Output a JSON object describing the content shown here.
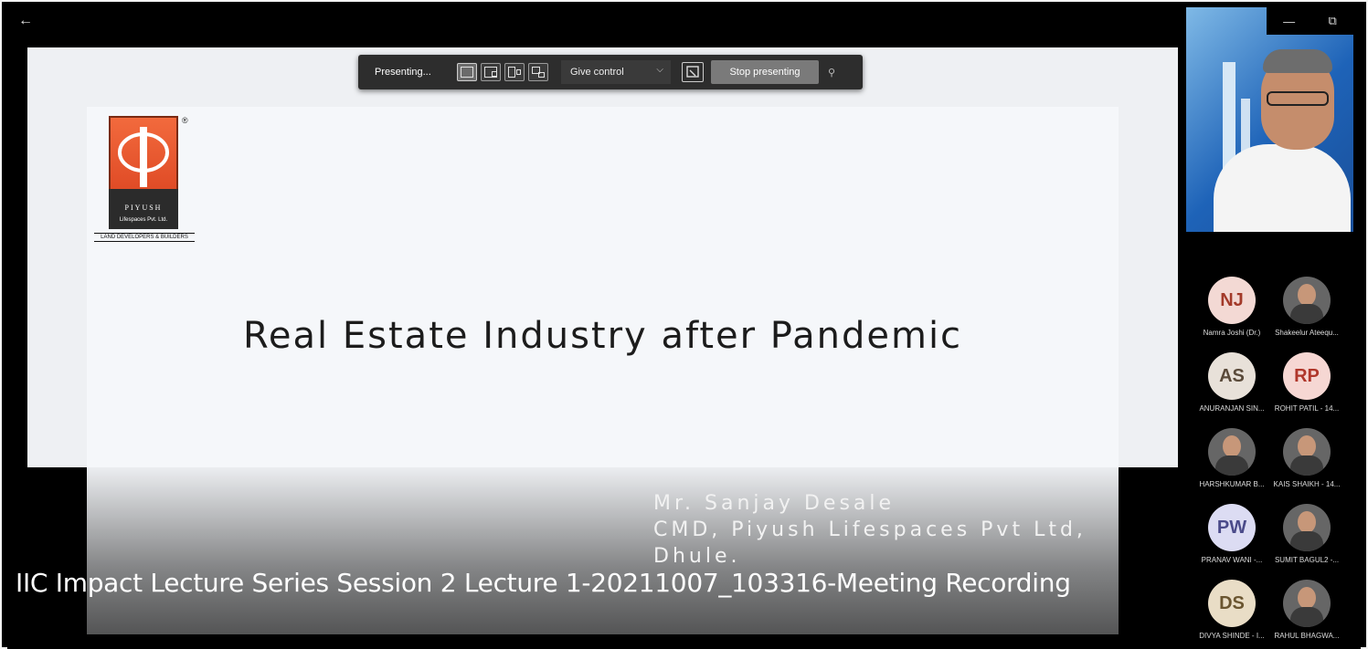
{
  "toolbar": {
    "presenting_label": "Presenting...",
    "give_control_label": "Give control",
    "stop_presenting_label": "Stop presenting"
  },
  "slide": {
    "title": "Real Estate Industry after Pandemic",
    "logo": {
      "brand": "PIYUSH",
      "brand_sub": "Lifespaces Pvt. Ltd.",
      "tagline": "LAND DEVELOPERS & BUILDERS"
    },
    "presenter_lines": [
      "Mr. Sanjay Desale",
      "CMD, Piyush Lifespaces Pvt Ltd,",
      "Dhule."
    ]
  },
  "recording_title": "IIC Impact Lecture Series Session 2 Lecture 1-20211007_103316-Meeting Recording",
  "participants": [
    {
      "initials": "NJ",
      "name": "Namra Joshi (Dr.)",
      "bg": "#f3d9d4",
      "fg": "#a33a2a"
    },
    {
      "initials": "",
      "name": "Shakeelur Ateequ...",
      "photo": true
    },
    {
      "initials": "AS",
      "name": "ANURANJAN SIN...",
      "bg": "#e8e1d9",
      "fg": "#5a4a3a"
    },
    {
      "initials": "RP",
      "name": "ROHIT PATIL - 14...",
      "bg": "#f6d7d3",
      "fg": "#b0372b"
    },
    {
      "initials": "",
      "name": "HARSHKUMAR B...",
      "photo": true
    },
    {
      "initials": "",
      "name": "KAIS SHAIKH - 14...",
      "photo": true
    },
    {
      "initials": "PW",
      "name": "PRANAV WANI -...",
      "bg": "#dcdcf3",
      "fg": "#4b4b8a"
    },
    {
      "initials": "",
      "name": "SUMIT BAGUL2 -...",
      "photo": true
    },
    {
      "initials": "DS",
      "name": "DIVYA SHINDE - I...",
      "bg": "#e9ddc6",
      "fg": "#6a5530"
    },
    {
      "initials": "",
      "name": "RAHUL BHAGWA...",
      "photo": true
    }
  ],
  "window": {
    "minimize_glyph": "—",
    "restore_glyph": "⧉"
  },
  "icons": {
    "back": "←",
    "chevron": "⌵",
    "pin": "⚲"
  }
}
